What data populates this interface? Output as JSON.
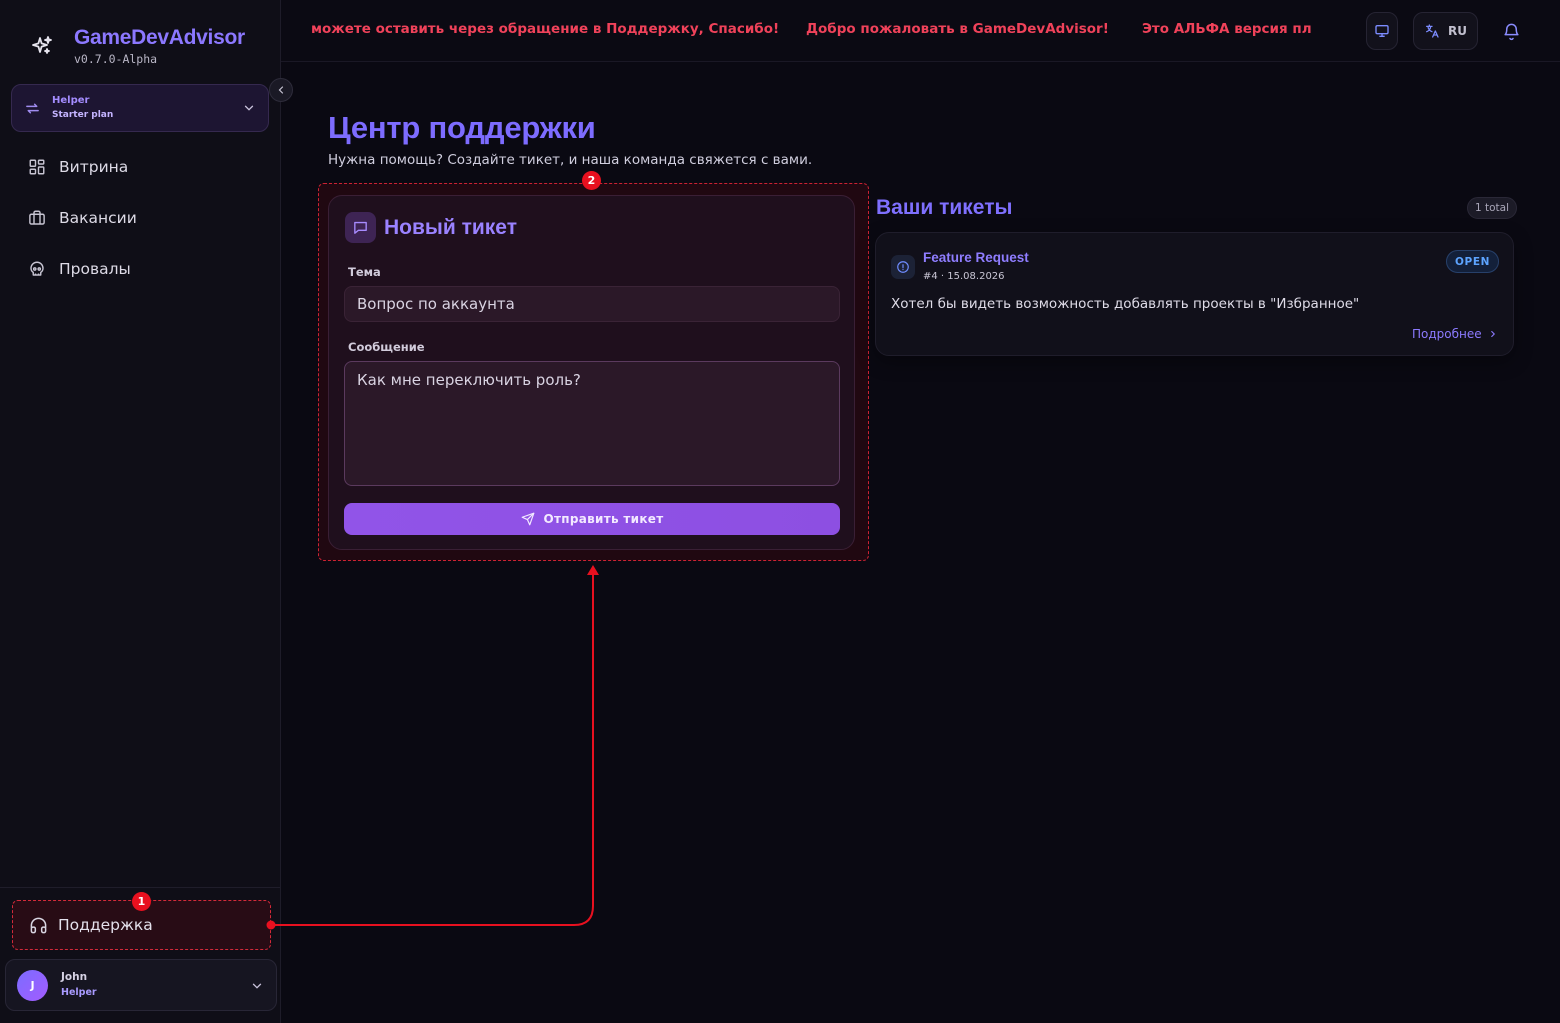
{
  "brand": {
    "name": "GameDevAdvisor",
    "version": "v0.7.0-Alpha"
  },
  "plan_switch": {
    "role": "Helper",
    "plan": "Starter plan"
  },
  "nav": {
    "items": [
      {
        "label": "Витрина",
        "icon": "grid-icon"
      },
      {
        "label": "Вакансии",
        "icon": "briefcase-icon"
      },
      {
        "label": "Провалы",
        "icon": "skull-icon"
      }
    ],
    "support_label": "Поддержка"
  },
  "user": {
    "initial": "J",
    "name": "John",
    "role": "Helper"
  },
  "topbar": {
    "announcements": [
      "можете оставить через обращение в Поддержку, Спасибо!",
      "Добро пожаловать в GameDevAdvisor!",
      "Это АЛЬФА версия плат"
    ],
    "language": "RU"
  },
  "page": {
    "title": "Центр поддержки",
    "subtitle": "Нужна помощь? Создайте тикет, и наша команда свяжется с вами."
  },
  "new_ticket": {
    "title": "Новый тикет",
    "topic_label": "Тема",
    "topic_value": "Вопрос по аккаунта",
    "message_label": "Сообщение",
    "message_value": "Как мне переключить роль?",
    "submit_label": "Отправить тикет"
  },
  "tickets": {
    "title": "Ваши тикеты",
    "total": "1 total",
    "items": [
      {
        "title": "Feature Request",
        "meta": "#4 · 15.08.2026",
        "status": "OPEN",
        "body": "Хотел бы видеть возможность добавлять проекты в \"Избранное\"",
        "more": "Подробнее"
      }
    ]
  },
  "annotations": {
    "badge_1": "1",
    "badge_2": "2"
  },
  "colors": {
    "accent": "#8c78ff",
    "alert": "#f0425a",
    "annotation": "#e8101f",
    "status_open": "#5da4ff",
    "button": "#9154e8"
  }
}
